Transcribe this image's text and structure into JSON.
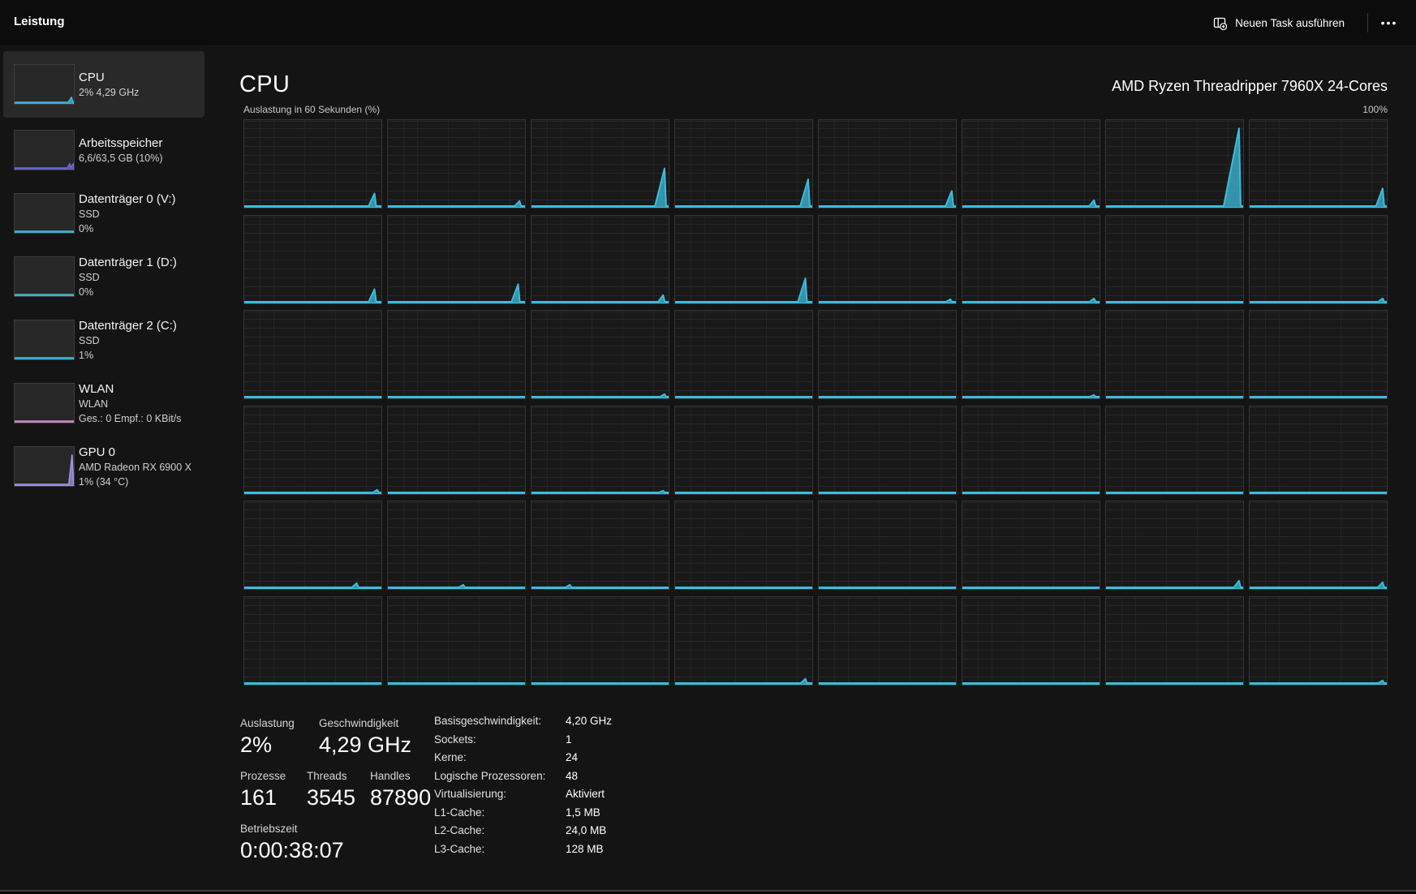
{
  "topbar": {
    "title": "Leistung",
    "new_task_label": "Neuen Task ausführen",
    "more_label": "•••"
  },
  "sidebar": {
    "items": [
      {
        "id": "cpu",
        "title": "CPU",
        "line2": "2% 4,29 GHz",
        "line3": "",
        "selected": true,
        "color": "#3dbbdc",
        "spikes": [
          [
            0.96,
            0.14,
            4
          ]
        ]
      },
      {
        "id": "memory",
        "title": "Arbeitsspeicher",
        "line2": "6,6/63,5 GB (10%)",
        "line3": "",
        "selected": false,
        "color": "#6e68cf",
        "spikes": [
          [
            0.93,
            0.12,
            3
          ],
          [
            0.99,
            0.12,
            3
          ]
        ]
      },
      {
        "id": "disk0",
        "title": "Datenträger 0 (V:)",
        "line2": "SSD",
        "line3": "0%",
        "selected": false,
        "color": "#3dbbdc",
        "spikes": []
      },
      {
        "id": "disk1",
        "title": "Datenträger 1 (D:)",
        "line2": "SSD",
        "line3": "0%",
        "selected": false,
        "color": "#3dbbdc",
        "spikes": []
      },
      {
        "id": "disk2",
        "title": "Datenträger 2 (C:)",
        "line2": "SSD",
        "line3": "1%",
        "selected": false,
        "color": "#3dbbdc",
        "spikes": []
      },
      {
        "id": "wlan",
        "title": "WLAN",
        "line2": "WLAN",
        "line3": "Ges.: 0 Empf.: 0 KBit/s",
        "selected": false,
        "color": "#d48cc8",
        "spikes": []
      },
      {
        "id": "gpu",
        "title": "GPU 0",
        "line2": "AMD Radeon RX 6900 X",
        "line3": "1% (34 °C)",
        "selected": false,
        "color": "#a695e2",
        "spikes": [
          [
            0.97,
            0.84,
            4
          ]
        ]
      }
    ]
  },
  "main": {
    "title": "CPU",
    "chip": "AMD Ryzen Threadripper 7960X 24-Cores",
    "graph_label": "Auslastung in 60 Sekunden (%)",
    "graph_max": "100%",
    "accent": "#3dbbdc",
    "cores": [
      [
        [
          0.95,
          0.15
        ]
      ],
      [
        [
          0.96,
          0.06
        ]
      ],
      [
        [
          0.97,
          0.45
        ]
      ],
      [
        [
          0.97,
          0.32
        ]
      ],
      [
        [
          0.97,
          0.18
        ]
      ],
      [
        [
          0.96,
          0.07
        ]
      ],
      [
        [
          0.97,
          0.93
        ]
      ],
      [
        [
          0.97,
          0.21
        ]
      ],
      [
        [
          0.95,
          0.15
        ]
      ],
      [
        [
          0.95,
          0.21
        ]
      ],
      [
        [
          0.96,
          0.08
        ]
      ],
      [
        [
          0.95,
          0.28
        ]
      ],
      [
        [
          0.96,
          0.03
        ]
      ],
      [
        [
          0.96,
          0.04
        ]
      ],
      [],
      [
        [
          0.97,
          0.04
        ]
      ],
      [],
      [],
      [
        [
          0.97,
          0.03
        ]
      ],
      [],
      [],
      [
        [
          0.96,
          0.02
        ]
      ],
      [],
      [],
      [
        [
          0.97,
          0.03
        ]
      ],
      [],
      [
        [
          0.96,
          0.02
        ]
      ],
      [],
      [],
      [],
      [],
      [],
      [
        [
          0.82,
          0.05
        ]
      ],
      [
        [
          0.55,
          0.03
        ]
      ],
      [
        [
          0.28,
          0.03
        ]
      ],
      [],
      [],
      [],
      [
        [
          0.97,
          0.08
        ]
      ],
      [
        [
          0.97,
          0.06
        ]
      ],
      [],
      [],
      [],
      [
        [
          0.95,
          0.05
        ]
      ],
      [],
      [],
      [],
      [
        [
          0.97,
          0.03
        ]
      ]
    ],
    "stats": {
      "primary": [
        {
          "label": "Auslastung",
          "value": "2%"
        },
        {
          "label": "Geschwindigkeit",
          "value": "4,29 GHz"
        }
      ],
      "secondary": [
        {
          "label": "Prozesse",
          "value": "161"
        },
        {
          "label": "Threads",
          "value": "3545"
        },
        {
          "label": "Handles",
          "value": "87890"
        }
      ],
      "uptime": {
        "label": "Betriebszeit",
        "value": "0:00:38:07"
      },
      "details": [
        {
          "label": "Basisgeschwindigkeit:",
          "value": "4,20 GHz"
        },
        {
          "label": "Sockets:",
          "value": "1"
        },
        {
          "label": "Kerne:",
          "value": "24"
        },
        {
          "label": "Logische Prozessoren:",
          "value": "48"
        },
        {
          "label": "Virtualisierung:",
          "value": "Aktiviert"
        },
        {
          "label": "L1-Cache:",
          "value": "1,5 MB"
        },
        {
          "label": "L2-Cache:",
          "value": "24,0 MB"
        },
        {
          "label": "L3-Cache:",
          "value": "128 MB"
        }
      ]
    }
  }
}
